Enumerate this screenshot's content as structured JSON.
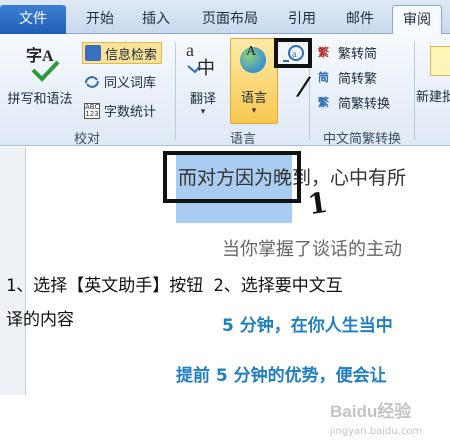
{
  "tabs": {
    "file": "文件",
    "home": "开始",
    "insert": "插入",
    "layout": "页面布局",
    "references": "引用",
    "mailings": "邮件",
    "review": "审阅"
  },
  "ribbon": {
    "proofing": {
      "spelling_icon": "字A",
      "spelling": "拼写和语法",
      "research": "信息检索",
      "thesaurus": "同义词库",
      "wordcount": "字数统计",
      "group": "校对"
    },
    "language": {
      "translate": "翻译",
      "language": "语言",
      "group": "语言"
    },
    "chinese": {
      "t2s": "繁转简",
      "s2t": "简转繁",
      "convert": "简繁转换",
      "group": "中文简繁转换"
    },
    "comments": {
      "new_comment": "新建批"
    }
  },
  "document": {
    "line1_selected": "而对方因为",
    "line1_rest": "晚到，心中有所",
    "line2": "当你掌握了谈话的主动",
    "step1": "1、选择【英文助手】按钮 2、选择要中文互",
    "step1_cont": "译的内容",
    "blue1": "5 分钟，在你人生当中",
    "blue2": "提前 5 分钟的优势，便会让"
  },
  "annotations": {
    "mark1": "1",
    "mark2": "/"
  },
  "watermark": {
    "brand": "Baidu经验",
    "url": "jingyan.baidu.com"
  },
  "colors": {
    "file_tab": "#2a6cc4",
    "selection": "#a9cdf0",
    "blue_text": "#1f7fc0",
    "highlight_box": "#111111"
  }
}
